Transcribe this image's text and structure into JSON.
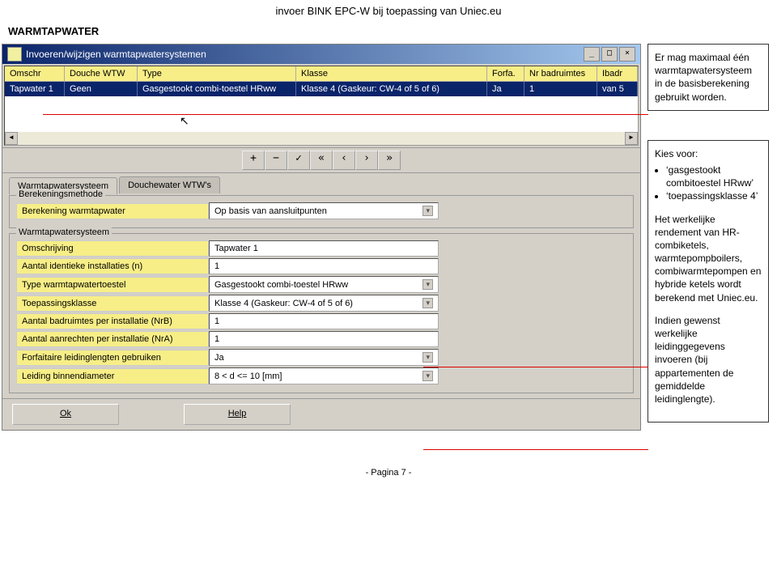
{
  "page": {
    "header": "invoer BINK EPC-W bij toepassing van Uniec.eu",
    "section": "WARMTAPWATER",
    "footer": "- Pagina 7 -"
  },
  "window": {
    "title": "Invoeren/wijzigen warmtapwatersystemen"
  },
  "grid": {
    "headers": {
      "c1": "Omschr",
      "c2": "Douche WTW",
      "c3": "Type",
      "c4": "Klasse",
      "c5": "Forfa.",
      "c6": "Nr badruimtes",
      "c7": "Ibadr"
    },
    "row": {
      "c1": "Tapwater 1",
      "c2": "Geen",
      "c3": "Gasgestookt combi-toestel HRww",
      "c4": "Klasse 4  (Gaskeur: CW-4 of 5 of 6)",
      "c5": "Ja",
      "c6": "1",
      "c7": "van 5"
    }
  },
  "toolbar": {
    "add": "+",
    "remove": "−",
    "check": "✓",
    "first": "«",
    "prev": "‹",
    "next": "›",
    "last": "»"
  },
  "tabs": {
    "t1": "Warmtapwatersysteem",
    "t2": "Douchewater WTW's"
  },
  "group1": {
    "legend": "Berekeningsmethode",
    "label": "Berekening warmtapwater",
    "value": "Op basis van aansluitpunten"
  },
  "group2": {
    "legend": "Warmtapwatersysteem",
    "f1l": "Omschrijving",
    "f1v": "Tapwater 1",
    "f2l": "Aantal identieke installaties (n)",
    "f2v": "1",
    "f3l": "Type warmtapwatertoestel",
    "f3v": "Gasgestookt combi-toestel HRww",
    "f4l": "Toepassingsklasse",
    "f4v": "Klasse 4  (Gaskeur: CW-4 of 5 of 6)",
    "f5l": "Aantal badruimtes per installatie (NrB)",
    "f5v": "1",
    "f6l": "Aantal aanrechten per installatie (NrA)",
    "f6v": "1",
    "f7l": "Forfaitaire leidinglengten gebruiken",
    "f7v": "Ja",
    "f8l": "Leiding binnendiameter",
    "f8v": "8 < d <= 10 [mm]"
  },
  "buttons": {
    "ok": "Ok",
    "help": "Help"
  },
  "notes": {
    "n1": "Er mag maximaal één warmtapwatersysteem in de basisberekening gebruikt worden.",
    "n2_intro": "Kies voor:",
    "n2_b1": "‘gasgestookt combitoestel HRww’",
    "n2_b2": "‘toepassingsklasse 4’",
    "n2_p2": "Het werkelijke rendement van HR-combiketels, warmtepompboilers, combiwarmtepompen en hybride ketels wordt berekend met Uniec.eu.",
    "n2_p3": "Indien gewenst werkelijke leidinggegevens invoeren (bij appartementen de gemiddelde leidinglengte)."
  }
}
